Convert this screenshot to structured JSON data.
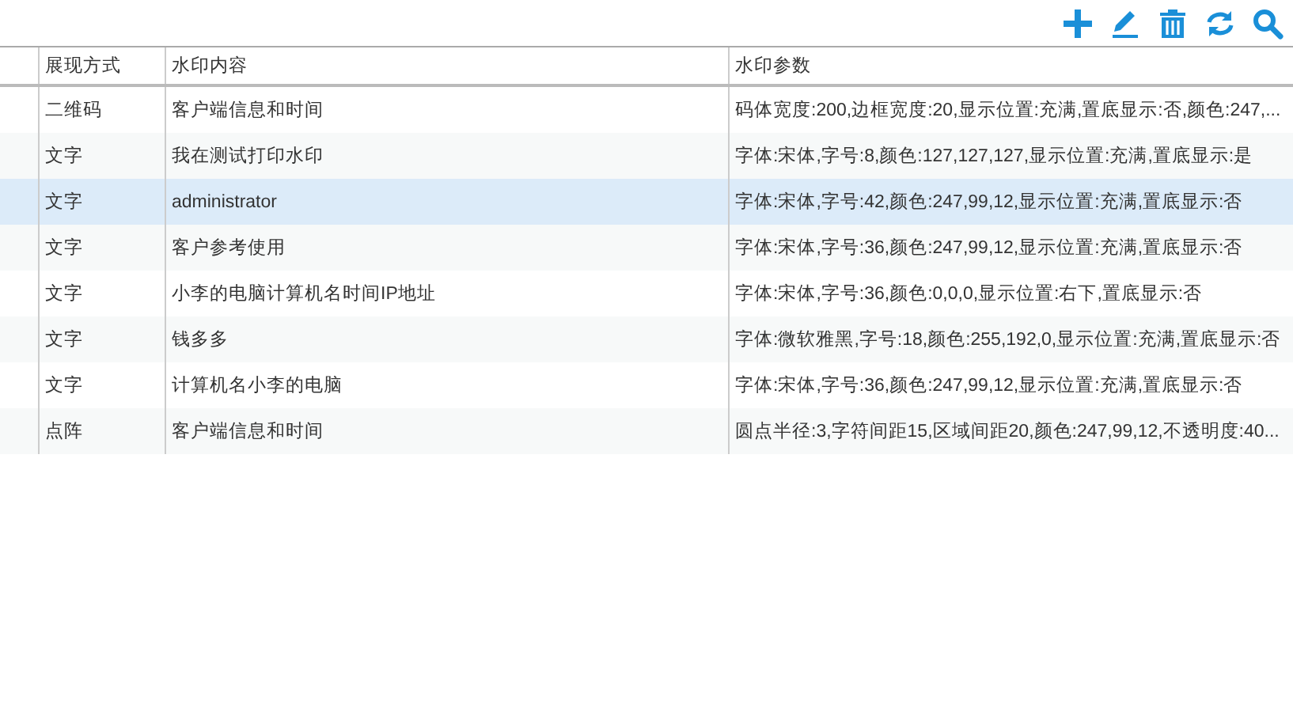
{
  "toolbar": {
    "buttons": [
      {
        "kind": "add"
      },
      {
        "kind": "edit"
      },
      {
        "kind": "delete"
      },
      {
        "kind": "refresh"
      },
      {
        "kind": "search"
      }
    ]
  },
  "table": {
    "columns": [
      "展现方式",
      "水印内容",
      "水印参数"
    ],
    "rows": [
      {
        "selected": false,
        "cells": [
          "二维码",
          "客户端信息和时间",
          "码体宽度:200,边框宽度:20,显示位置:充满,置底显示:否,颜色:247,..."
        ]
      },
      {
        "selected": false,
        "cells": [
          "文字",
          "我在测试打印水印",
          "字体:宋体,字号:8,颜色:127,127,127,显示位置:充满,置底显示:是"
        ]
      },
      {
        "selected": true,
        "cells": [
          "文字",
          "administrator",
          "字体:宋体,字号:42,颜色:247,99,12,显示位置:充满,置底显示:否"
        ]
      },
      {
        "selected": false,
        "cells": [
          "文字",
          "客户参考使用",
          "字体:宋体,字号:36,颜色:247,99,12,显示位置:充满,置底显示:否"
        ]
      },
      {
        "selected": false,
        "cells": [
          "文字",
          "小李的电脑计算机名时间IP地址",
          "字体:宋体,字号:36,颜色:0,0,0,显示位置:右下,置底显示:否"
        ]
      },
      {
        "selected": false,
        "cells": [
          "文字",
          "钱多多",
          "字体:微软雅黑,字号:18,颜色:255,192,0,显示位置:充满,置底显示:否"
        ]
      },
      {
        "selected": false,
        "cells": [
          "文字",
          "计算机名小李的电脑",
          "字体:宋体,字号:36,颜色:247,99,12,显示位置:充满,置底显示:否"
        ]
      },
      {
        "selected": false,
        "cells": [
          "点阵",
          "客户端信息和时间",
          "圆点半径:3,字符间距15,区域间距20,颜色:247,99,12,不透明度:40..."
        ]
      }
    ]
  }
}
